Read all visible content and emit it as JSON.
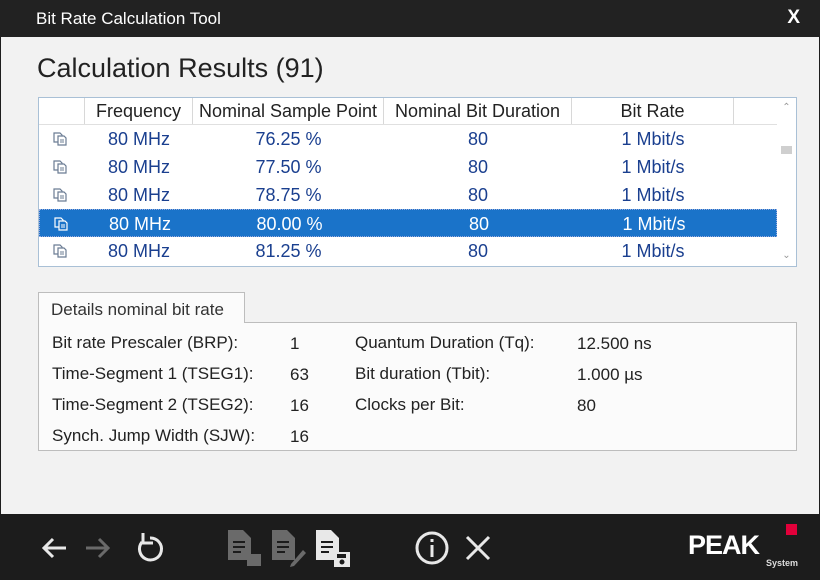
{
  "window": {
    "title": "Bit Rate Calculation Tool",
    "close_label": "X"
  },
  "results": {
    "heading": "Calculation Results (91)",
    "columns": [
      "Frequency",
      "Nominal Sample Point",
      "Nominal Bit Duration",
      "Bit Rate"
    ],
    "rows": [
      {
        "frequency": "80 MHz",
        "sample_point": "76.25 %",
        "bit_duration": "80",
        "bit_rate": "1 Mbit/s",
        "selected": false
      },
      {
        "frequency": "80 MHz",
        "sample_point": "77.50 %",
        "bit_duration": "80",
        "bit_rate": "1 Mbit/s",
        "selected": false
      },
      {
        "frequency": "80 MHz",
        "sample_point": "78.75 %",
        "bit_duration": "80",
        "bit_rate": "1 Mbit/s",
        "selected": false
      },
      {
        "frequency": "80 MHz",
        "sample_point": "80.00 %",
        "bit_duration": "80",
        "bit_rate": "1 Mbit/s",
        "selected": true
      },
      {
        "frequency": "80 MHz",
        "sample_point": "81.25 %",
        "bit_duration": "80",
        "bit_rate": "1 Mbit/s",
        "selected": false
      }
    ]
  },
  "details": {
    "tab_label": "Details nominal bit rate",
    "brp_label": "Bit rate Prescaler (BRP):",
    "brp_value": "1",
    "tseg1_label": "Time-Segment 1 (TSEG1):",
    "tseg1_value": "63",
    "tseg2_label": "Time-Segment 2 (TSEG2):",
    "tseg2_value": "16",
    "sjw_label": "Synch. Jump Width (SJW):",
    "sjw_value": "16",
    "tq_label": "Quantum Duration (Tq):",
    "tq_value": "12.500 ns",
    "tbit_label": "Bit duration (Tbit):",
    "tbit_value": "1.000 µs",
    "clocks_label": "Clocks per Bit:",
    "clocks_value": "80"
  },
  "footer": {
    "icons": [
      "back-arrow-icon",
      "forward-arrow-icon",
      "reset-icon",
      "copy-document-icon",
      "edit-document-icon",
      "save-document-icon",
      "info-icon",
      "close-icon"
    ],
    "logo_text": "PEAK",
    "logo_sub": "System",
    "colors": {
      "background": "#1c1c1c",
      "active_icon": "#e8e8e8",
      "disabled_icon": "#6a6a6a",
      "brand_red": "#e2003a"
    }
  },
  "colors": {
    "selection": "#1a73c9",
    "grid_text": "#1a3f8f"
  }
}
